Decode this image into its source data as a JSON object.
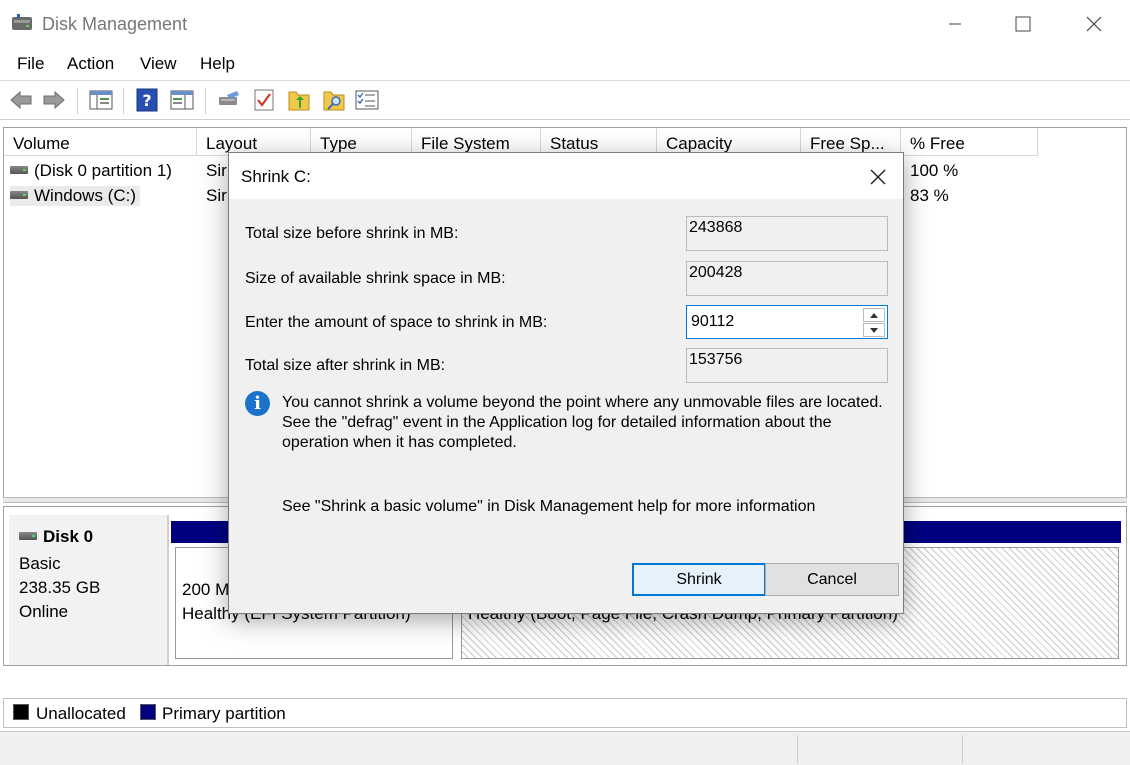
{
  "window": {
    "title": "Disk Management",
    "icon": "disk-management-icon"
  },
  "menu": [
    "File",
    "Action",
    "View",
    "Help"
  ],
  "toolbar": {
    "icons": [
      "back-arrow-icon",
      "forward-arrow-icon",
      "console-tree-icon",
      "help-icon",
      "show-hide-icon",
      "connect-icon",
      "properties-icon",
      "up-folder-icon",
      "search-folder-icon",
      "list-view-icon"
    ]
  },
  "volume_list": {
    "columns": [
      "Volume",
      "Layout",
      "Type",
      "File System",
      "Status",
      "Capacity",
      "Free Sp...",
      "% Free"
    ],
    "rows": [
      {
        "volume": "(Disk 0 partition 1)",
        "layout": "Sir",
        "free_pct": "100 %"
      },
      {
        "volume": "Windows (C:)",
        "layout": "Sir",
        "free_pct": "83 %"
      }
    ]
  },
  "disk": {
    "name": "Disk 0",
    "type": "Basic",
    "size": "238.35 GB",
    "state": "Online",
    "partitions": [
      {
        "line1": "200 M",
        "line2": "Healthy (EFI System Partition)"
      },
      {
        "line1": "",
        "line2": "Healthy (Boot, Page File, Crash Dump, Primary Partition)"
      }
    ]
  },
  "legend": [
    {
      "label": "Unallocated",
      "color": "#000000"
    },
    {
      "label": "Primary partition",
      "color": "#000080"
    }
  ],
  "dialog": {
    "title": "Shrink C:",
    "total_before_label": "Total size before shrink in MB:",
    "total_before_value": "243868",
    "available_label": "Size of available shrink space in MB:",
    "available_value": "200428",
    "amount_label": "Enter the amount of space to shrink in MB:",
    "amount_value": "90112",
    "total_after_label": "Total size after shrink in MB:",
    "total_after_value": "153756",
    "info_text": "You cannot shrink a volume beyond the point where any unmovable files are located. See the \"defrag\" event in the Application log for detailed information about the operation when it has completed.",
    "help_text": "See \"Shrink a basic volume\" in Disk Management help for more information",
    "shrink_button": "Shrink",
    "cancel_button": "Cancel"
  },
  "colors": {
    "accent": "#0078d7",
    "primary_partition": "#000080",
    "info_icon": "#1a73c8"
  }
}
